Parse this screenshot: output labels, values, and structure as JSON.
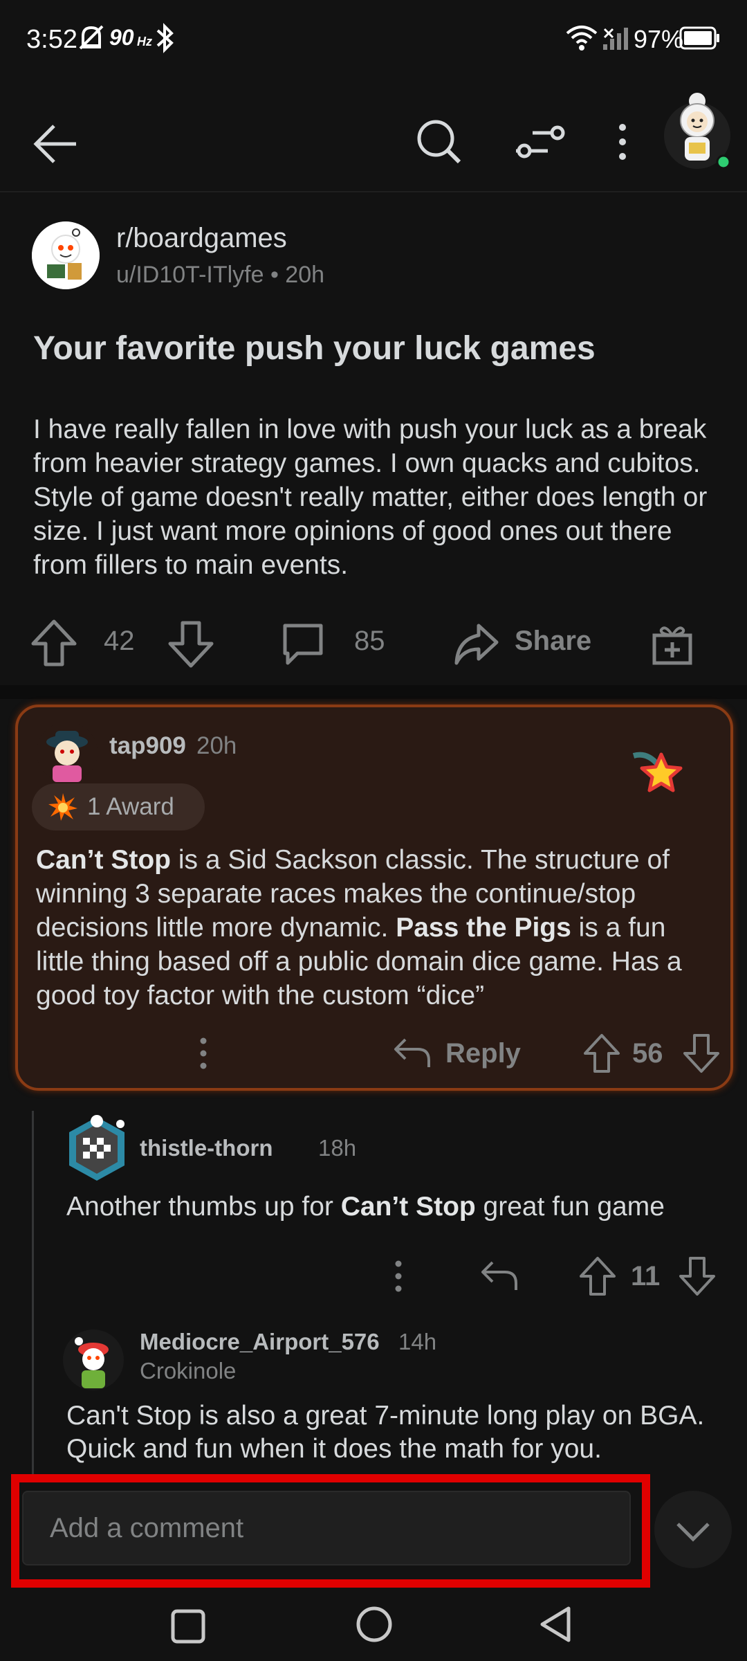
{
  "status_bar": {
    "time": "3:52",
    "refresh_rate": "90",
    "refresh_unit": "Hz",
    "battery": "97%"
  },
  "post": {
    "subreddit": "r/boardgames",
    "meta": "u/ID10T-ITlyfe • 20h",
    "title": "Your favorite push your luck games",
    "body": "I have really fallen in love with push your luck as a break from heavier strategy games. I own quacks and cubitos. Style of game doesn't really matter, either does length or size. I just want more opinions of good ones out there from fillers to main events.",
    "score": "42",
    "comment_count": "85",
    "share_label": "Share"
  },
  "comments": {
    "top": {
      "author": "tap909",
      "time": "20h",
      "award_label": "1 Award",
      "body_part1": "Can’t Stop",
      "body_part2": " is a Sid Sackson classic. The structure of winning 3 separate races makes the continue/stop decisions little more dynamic. ",
      "body_part3": "Pass the Pigs",
      "body_part4": " is a fun little thing based off a public domain dice game. Has a good toy factor with the custom “dice”",
      "reply_label": "Reply",
      "score": "56"
    },
    "reply1": {
      "author": "thistle-thorn",
      "time": "18h",
      "body_part1": "Another thumbs up for ",
      "body_part2": "Can’t Stop",
      "body_part3": " great fun game",
      "score": "11"
    },
    "reply2": {
      "author": "Mediocre_Airport_576",
      "time": "14h",
      "flair": "Crokinole",
      "body": "Can't Stop is also a great 7-minute long play on BGA. Quick and fun when it does the math for you."
    }
  },
  "comment_bar": {
    "placeholder": "Add a comment"
  },
  "colors": {
    "background": "#121212",
    "highlight_border": "#8a3b14",
    "highlight_bg": "#2a1a14",
    "annotation_red": "#e00000",
    "online_dot": "#2ecc71"
  }
}
